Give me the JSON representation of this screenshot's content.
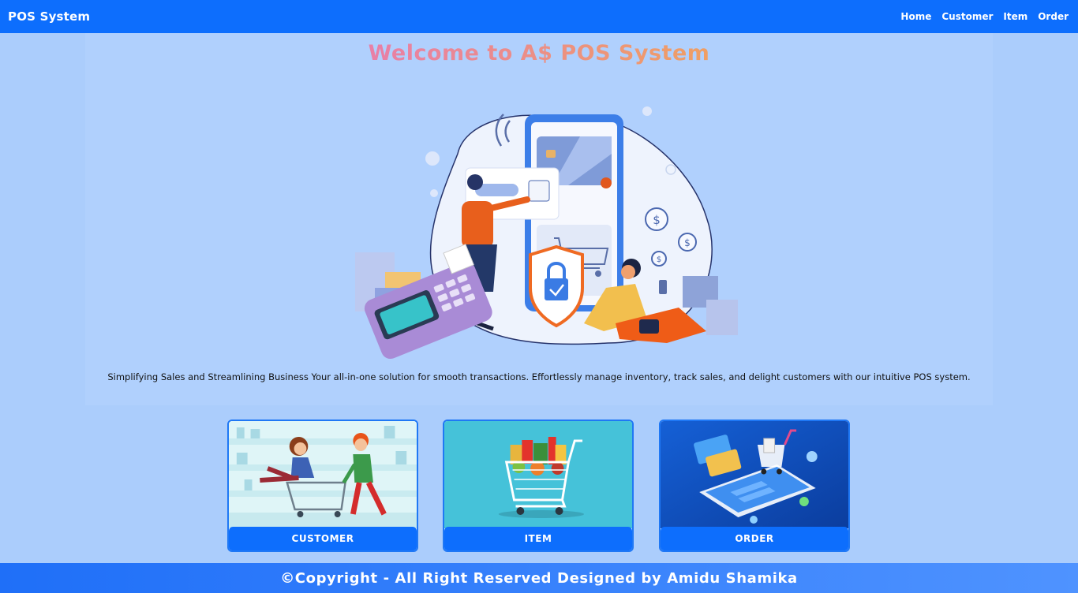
{
  "navbar": {
    "brand": "POS System",
    "links": [
      "Home",
      "Customer",
      "Item",
      "Order"
    ]
  },
  "hero": {
    "title": "Welcome to A$ POS System",
    "tagline": "Simplifying Sales and Streamlining Business Your all-in-one solution for smooth transactions. Effortlessly manage inventory, track sales, and delight customers with our intuitive POS system."
  },
  "cards": [
    {
      "label": "CUSTOMER",
      "image": "shopping-cart-people-illustration"
    },
    {
      "label": "ITEM",
      "image": "grocery-cart-illustration"
    },
    {
      "label": "ORDER",
      "image": "mobile-payment-illustration"
    }
  ],
  "footer": {
    "text": "©Copyright - All Right Reserved Designed by Amidu Shamika"
  },
  "colors": {
    "primary": "#0d6efd",
    "background": "#abcdfc",
    "title_pink": "#e77bb0",
    "title_orange": "#f0a35a"
  }
}
